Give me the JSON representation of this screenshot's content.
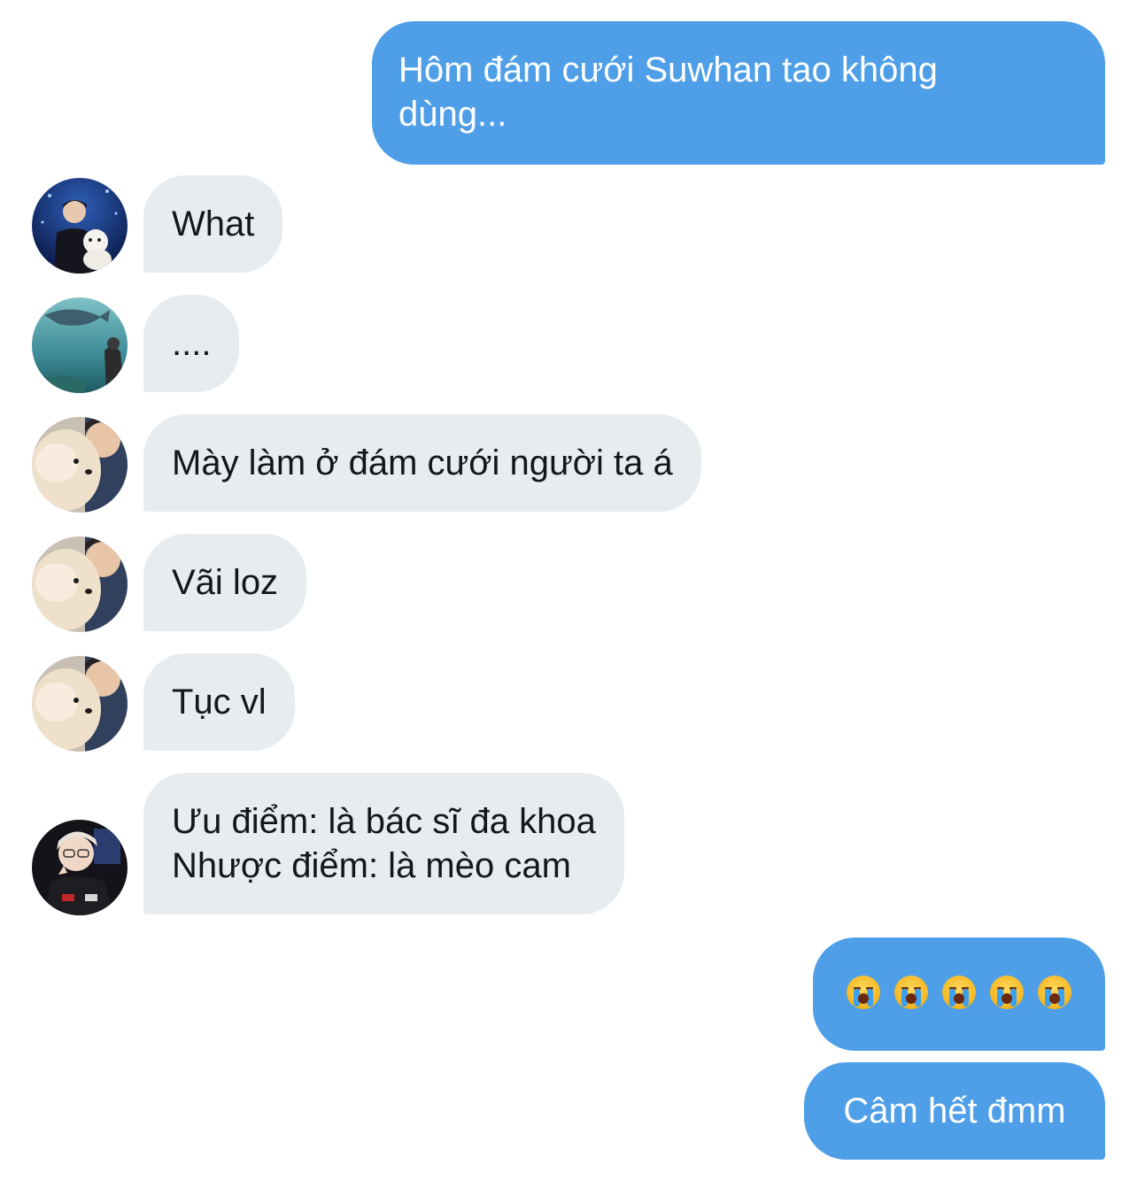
{
  "messages": [
    {
      "id": "m1",
      "side": "sent",
      "text": "Hôm đám cưới Suwhan tao không\ndùng..."
    },
    {
      "id": "m2",
      "side": "received",
      "text": "What",
      "avatar": "avatar-1"
    },
    {
      "id": "m3",
      "side": "received",
      "text": "....",
      "avatar": "avatar-2"
    },
    {
      "id": "m4",
      "side": "received",
      "text": "Mày làm ở đám cưới người ta á",
      "avatar": "avatar-3"
    },
    {
      "id": "m5",
      "side": "received",
      "text": "Vãi loz",
      "avatar": "avatar-3"
    },
    {
      "id": "m6",
      "side": "received",
      "text": "Tục vl",
      "avatar": "avatar-3"
    },
    {
      "id": "m7",
      "side": "received",
      "lines": [
        "Ưu điểm: là bác sĩ đa khoa",
        "Nhược điểm: là mèo cam"
      ],
      "avatar": "avatar-4"
    },
    {
      "id": "m8",
      "side": "sent",
      "emoji": "loudly-crying-face",
      "emoji_count": 5
    },
    {
      "id": "m9",
      "side": "sent",
      "text": "Câm hết đmm"
    }
  ],
  "colors": {
    "sent_bubble": "#4e9fe8",
    "received_bubble": "#e6ecf0",
    "received_text": "#14171a",
    "sent_text": "#ffffff"
  }
}
